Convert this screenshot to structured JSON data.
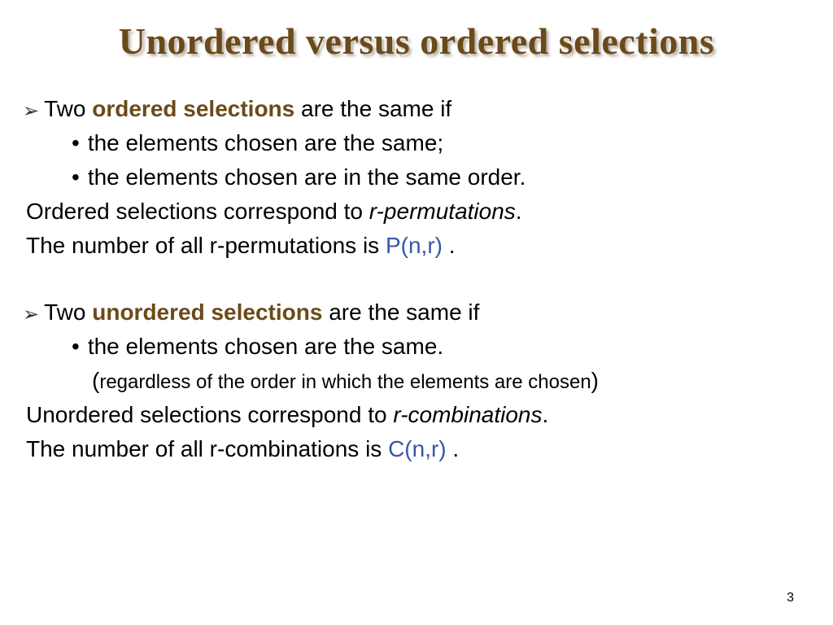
{
  "title": "Unordered versus ordered selections",
  "section1": {
    "lead_prefix": "Two ",
    "lead_emph": "ordered selections",
    "lead_suffix": " are the same if",
    "sub1": "the elements chosen are the same;",
    "sub2": "the elements chosen are in the same order.",
    "line3_pre": "Ordered selections correspond to ",
    "line3_ital": "r-permutations",
    "line3_post": ".",
    "line4_pre": "The number of all r-permutations is ",
    "line4_formula": "P(n,r)",
    "line4_post": " ."
  },
  "section2": {
    "lead_prefix": "Two ",
    "lead_emph": "unordered selections",
    "lead_suffix": " are the same if",
    "sub1": "the elements chosen are the same.",
    "note": "regardless of the order in which the elements are chosen",
    "line3_pre": "Unordered selections correspond to ",
    "line3_ital": "r-combinations",
    "line3_post": ".",
    "line4_pre": "The number of all r-combinations is ",
    "line4_formula": "C(n,r)",
    "line4_post": " ."
  },
  "page_number": "3"
}
